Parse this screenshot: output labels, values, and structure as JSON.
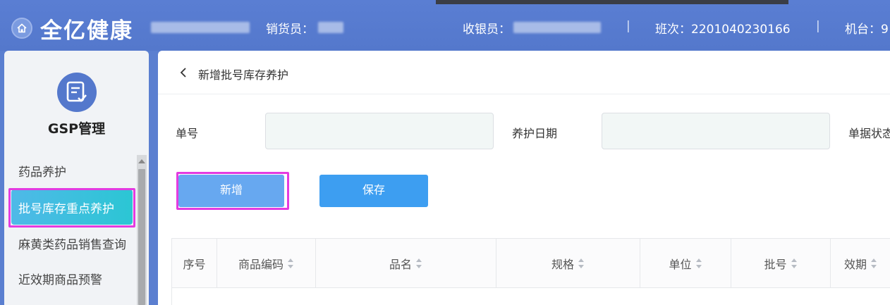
{
  "header": {
    "brand": "全亿健康",
    "seller_label": "销货员：",
    "cashier_label": "收银员：",
    "shift_label": "班次：2201040230166",
    "separator": "|",
    "machine_label": "机台：9"
  },
  "sidebar": {
    "module_title": "GSP管理",
    "items": [
      {
        "label": "药品养护"
      },
      {
        "label": "批号库存重点养护"
      },
      {
        "label": "麻黄类药品销售查询"
      },
      {
        "label": "近效期商品预警"
      }
    ]
  },
  "main": {
    "page_title": "新增批号库存养护",
    "fields": {
      "order_no_label": "单号",
      "order_no_value": "",
      "care_date_label": "养护日期",
      "care_date_value": "",
      "status_label": "单据状态"
    },
    "buttons": {
      "add": "新增",
      "save": "保存"
    },
    "table": {
      "columns": [
        "序号",
        "商品编码",
        "品名",
        "规格",
        "单位",
        "批号",
        "效期"
      ]
    }
  },
  "colors": {
    "header_bg": "#5478cc",
    "active_menu": "#2bc6d4",
    "highlight": "#e33be0",
    "save_button": "#3d9ef1"
  }
}
